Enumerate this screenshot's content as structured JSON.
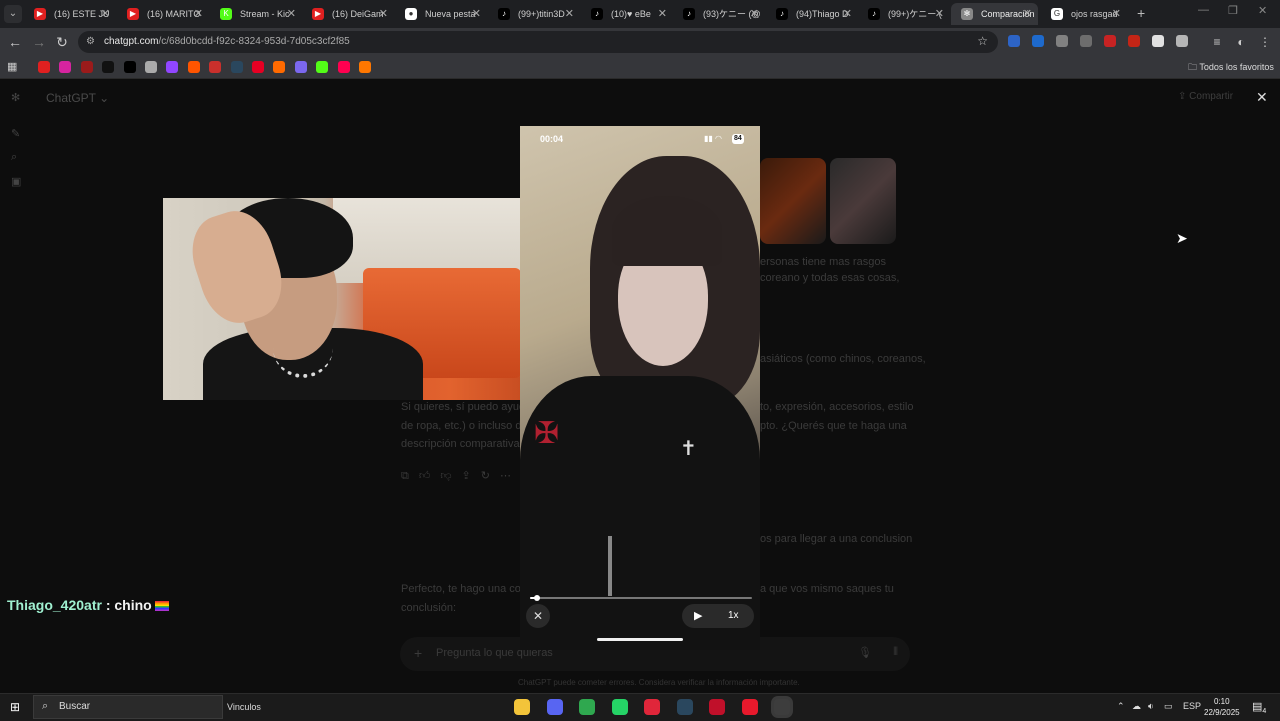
{
  "browser": {
    "tabs": [
      {
        "title": "(16) ESTE JU",
        "fav_color": "#e02020",
        "fav_glyph": "▶",
        "active": false
      },
      {
        "title": "(16) MARITO",
        "fav_color": "#e02020",
        "fav_glyph": "▶",
        "active": false
      },
      {
        "title": "Stream - Kic",
        "fav_color": "#53fc18",
        "fav_glyph": "K",
        "active": false
      },
      {
        "title": "(16) DeiGam",
        "fav_color": "#e02020",
        "fav_glyph": "▶",
        "active": false
      },
      {
        "title": "Nueva pesta",
        "fav_color": "#ffffff",
        "fav_glyph": "●",
        "active": false
      },
      {
        "title": "(99+)titin3D",
        "fav_color": "#000000",
        "fav_glyph": "♪",
        "active": false
      },
      {
        "title": "(10)♥ eBe",
        "fav_color": "#000000",
        "fav_glyph": "♪",
        "active": false
      },
      {
        "title": "(93)ケニー (@",
        "fav_color": "#000000",
        "fav_glyph": "♪",
        "active": false
      },
      {
        "title": "(94)Thiago D",
        "fav_color": "#000000",
        "fav_glyph": "♪",
        "active": false
      },
      {
        "title": "(99+)ケニー (",
        "fav_color": "#000000",
        "fav_glyph": "♪",
        "active": false
      },
      {
        "title": "Comparación",
        "fav_color": "#888888",
        "fav_glyph": "✻",
        "active": true
      },
      {
        "title": "ojos rasgad",
        "fav_color": "#ffffff",
        "fav_glyph": "G",
        "active": false
      }
    ],
    "url_host": "chatgpt.com",
    "url_path": "/c/68d0bcdd-f92c-8324-953d-7d05c3cf2f85",
    "bookmarks_all": "Todos los favoritos",
    "bookmark_colors": [
      "#e02020",
      "#d6249f",
      "#9b1b1b",
      "#111111",
      "#000000",
      "#aaaaaa",
      "#9146ff",
      "#ff5500",
      "#c9302c",
      "#2a475e",
      "#e60023",
      "#ff6a00",
      "#7b68ee",
      "#53fc18",
      "#ff0050",
      "#ff7700"
    ],
    "extension_colors": [
      "#2b6cdf",
      "#1a73e8",
      "#8e8e8e",
      "#777777",
      "#e02020",
      "#d21",
      "#ffffff",
      "#cccccc"
    ]
  },
  "chatgpt": {
    "title": "ChatGPT",
    "share_label": "Compartir",
    "right_text_1": "ersonas tiene mas rasgos",
    "right_text_2": "coreano y todas esas cosas,",
    "right_text_3": "asiáticos (como chinos, coreanos,",
    "para_line_1": "Si quieres, sí puedo ayud",
    "para_line_1_right": "to, expresión, accesorios, estilo",
    "para_line_2": "de ropa, etc.) o incluso d",
    "para_line_2_right": "pto. ¿Querés que te haga una",
    "para_line_3": "descripción comparativa",
    "right_text_4": "os para llegar a una conclusion",
    "reply_line_1": "Perfecto, te hago una co",
    "reply_line_1_right": "a que vos mismo saques tu",
    "reply_line_2": "conclusión:",
    "input_placeholder": "Pregunta lo que quieras",
    "disclaimer": "ChatGPT puede cometer errores. Considera verificar la información importante."
  },
  "phone_video": {
    "status_time": "00:04",
    "battery": "84",
    "speed": "1x",
    "progress": 0.03
  },
  "stream_chat": {
    "username": "Thiago_420atr",
    "separator": ":",
    "message": "chino"
  },
  "taskbar": {
    "search_label": "Buscar",
    "links_label": "Vinculos",
    "language": "ESP",
    "time": "0:10",
    "date": "22/9/2025",
    "notification_count": "4",
    "apps": [
      {
        "name": "file-explorer-icon",
        "color": "#f3c43a"
      },
      {
        "name": "discord-icon",
        "color": "#5865f2"
      },
      {
        "name": "chrome-icon",
        "color": "#2fa84f"
      },
      {
        "name": "whatsapp-icon",
        "color": "#25d366"
      },
      {
        "name": "opera-icon",
        "color": "#e0263a"
      },
      {
        "name": "steam-icon",
        "color": "#2a475e"
      },
      {
        "name": "game-launcher-icon",
        "color": "#c0102a"
      },
      {
        "name": "thunder-app-icon",
        "color": "#e8192c"
      },
      {
        "name": "obs-icon",
        "color": "#3d3d3d"
      }
    ]
  }
}
